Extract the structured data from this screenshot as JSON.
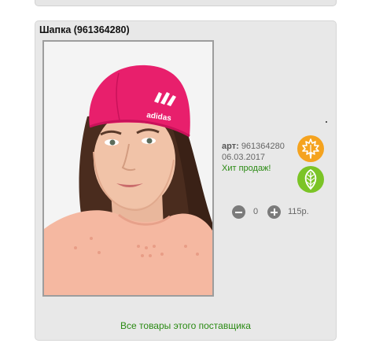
{
  "product": {
    "title": "Шапка (961364280)",
    "art_label": "арт:",
    "art_value": "961364280",
    "date": "06.03.2017",
    "hit_label": "Хит продаж!",
    "brand_print": "adidas"
  },
  "season_badges": [
    {
      "name": "autumn",
      "icon": "maple-leaf-icon",
      "color": "#f5a31f"
    },
    {
      "name": "spring",
      "icon": "leaf-icon",
      "color": "#7bc426"
    }
  ],
  "cart": {
    "quantity": "0",
    "price": "115р."
  },
  "supplier_link": "Все товары этого поставщика",
  "colors": {
    "accent_green": "#2a8a13",
    "hat_pink": "#e81f6c"
  }
}
